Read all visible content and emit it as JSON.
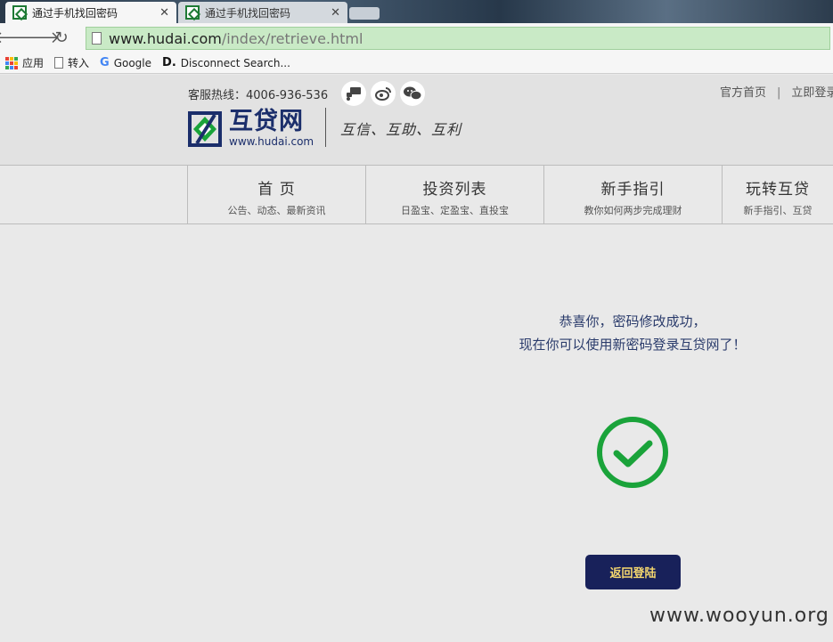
{
  "browser": {
    "tabs": [
      {
        "title": "通过手机找回密码",
        "active": true
      },
      {
        "title": "通过手机找回密码",
        "active": false
      }
    ],
    "url_host": "www.hudai.com",
    "url_path": "/index/retrieve.html",
    "bookmarks": [
      {
        "label": "应用",
        "icon": "apps-grid-icon"
      },
      {
        "label": "转入",
        "icon": "page-icon"
      },
      {
        "label": "Google",
        "icon": "google-icon"
      },
      {
        "label": "Disconnect Search...",
        "icon": "disconnect-icon"
      }
    ]
  },
  "header": {
    "hotline": "客服热线：4006-936-536",
    "links": [
      "官方首页",
      "|",
      "立即登录"
    ],
    "logo_cn": "互贷网",
    "logo_url": "www.hudai.com",
    "slogan": "互信、互助、互利"
  },
  "nav": [
    {
      "title": "首 页",
      "sub": "公告、动态、最新资讯"
    },
    {
      "title": "投资列表",
      "sub": "日盈宝、定盈宝、直投宝"
    },
    {
      "title": "新手指引",
      "sub": "教你如何两步完成理财"
    },
    {
      "title": "玩转互贷",
      "sub": "新手指引、互贷"
    }
  ],
  "content": {
    "line1": "恭喜你，密码修改成功，",
    "line2": "现在你可以使用新密码登录互贷网了！",
    "button": "返回登陆"
  },
  "watermark": "www.wooyun.org",
  "colors": {
    "accent_green": "#1aa33a",
    "button_bg": "#18215a",
    "button_text": "#f5d76e",
    "message_text": "#2a3b6b"
  }
}
